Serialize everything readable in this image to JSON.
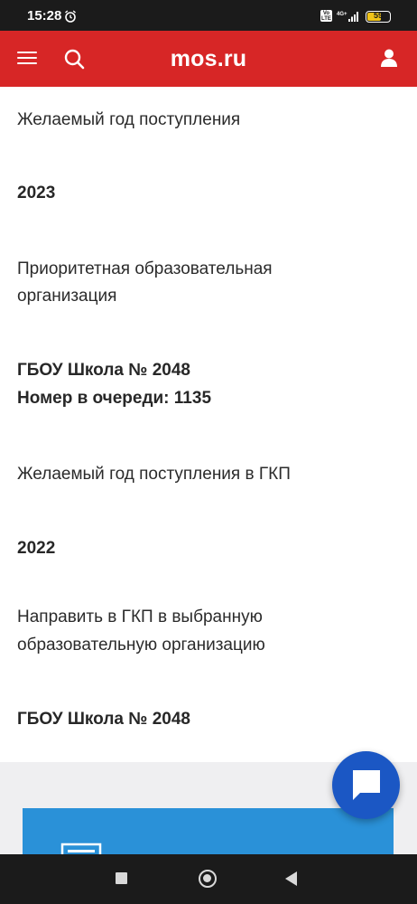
{
  "status_bar": {
    "time": "15:28",
    "alarm_icon": "alarm-icon",
    "volte": "Vo LTE",
    "network": "4G+",
    "battery": "59",
    "battery_level": 0.59
  },
  "header": {
    "logo": "mos.ru",
    "bg_color": "#d72626",
    "icons": [
      "menu-icon",
      "search-icon",
      "user-icon"
    ]
  },
  "fields": [
    {
      "label": "Желаемый год поступления",
      "value": "2023"
    },
    {
      "label": "Приоритетная образовательная организация",
      "value_lines": [
        "ГБОУ Школа № 2048",
        "Номер в очереди: 1135"
      ]
    },
    {
      "label": "Желаемый год поступления в ГКП",
      "value": "2022"
    },
    {
      "label": "Направить в ГКП в выбранную образовательную организацию",
      "value": "ГБОУ Школа № 2048"
    }
  ],
  "field_lines": {
    "label_1": "Желаемый год поступления",
    "value_1": "2023",
    "label_2_line_1": "Приоритетная образовательная",
    "label_2_line_2": "организация",
    "value_2_line_1": "ГБОУ Школа № 2048",
    "value_2_line_2": "Номер в очереди: 1135",
    "label_3": "Желаемый год поступления в ГКП",
    "value_3": "2022",
    "label_4_line_1": "Направить в ГКП в выбранную",
    "label_4_line_2": "образовательную организацию",
    "value_4": "ГБОУ Школа № 2048"
  },
  "chat_button": {
    "icon": "chat-icon",
    "color": "#1b57c4"
  },
  "card": {
    "icon": "printer-icon",
    "color": "#2a91d8"
  },
  "nav_bar": {
    "icons": [
      "recents-icon",
      "home-icon",
      "back-icon"
    ]
  }
}
